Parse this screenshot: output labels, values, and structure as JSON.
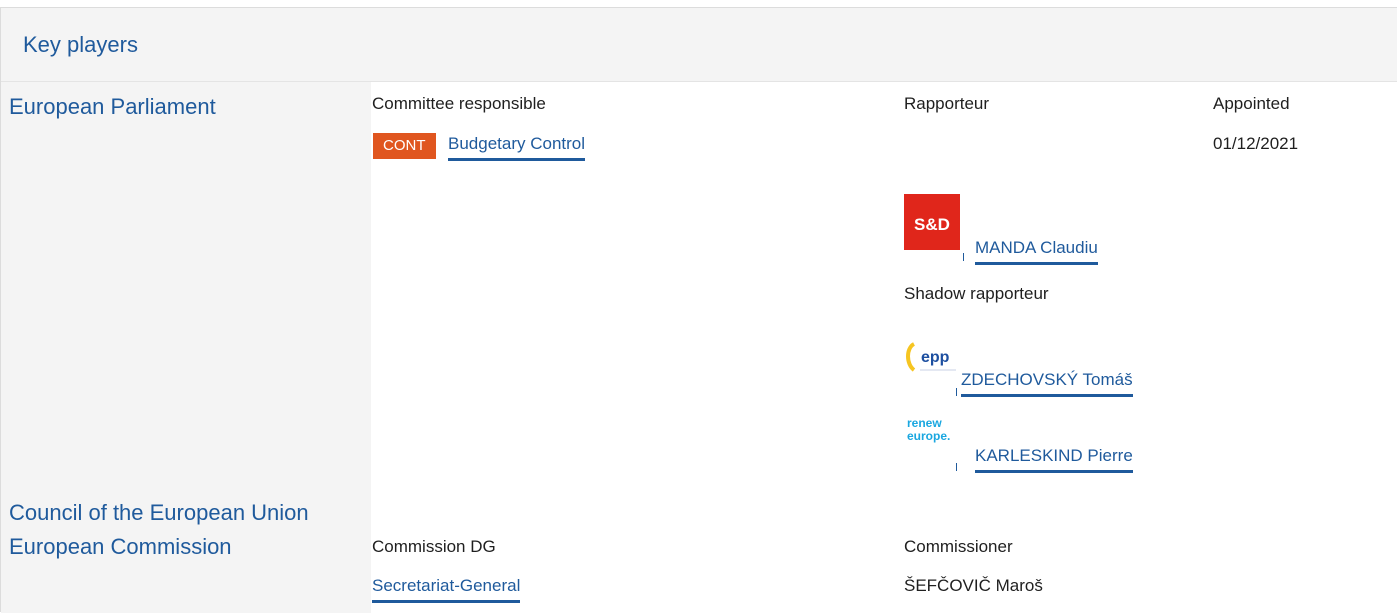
{
  "header": {
    "title": "Key players"
  },
  "institutions": {
    "ep": "European Parliament",
    "council": "Council of the European Union",
    "commission": "European Commission"
  },
  "parliament": {
    "committee_header": "Committee responsible",
    "rapporteur_header": "Rapporteur",
    "appointed_header": "Appointed",
    "committee_badge": "CONT",
    "committee_badge_color": "#e0561f",
    "committee_name": "Budgetary Control",
    "appointed_date": "01/12/2021",
    "rapporteur": {
      "group_logo": "S&D",
      "logo_color": "#e0261b",
      "name": "MANDA Claudiu"
    },
    "shadow_header": "Shadow rapporteur",
    "shadows": [
      {
        "group_logo_text": "epp",
        "logo_color": "#1d4fa0",
        "name": "ZDECHOVSKÝ Tomáš"
      },
      {
        "group_logo_text": "renew europe.",
        "logo_color": "#1aa7e0",
        "name": "KARLESKIND Pierre"
      }
    ]
  },
  "commission": {
    "dg_header": "Commission DG",
    "commissioner_header": "Commissioner",
    "dg_name": "Secretariat-General",
    "commissioner_name": "ŠEFČOVIČ Maroš"
  },
  "colors": {
    "accent": "#1f5a9c",
    "panel_bg": "#f4f4f4"
  }
}
